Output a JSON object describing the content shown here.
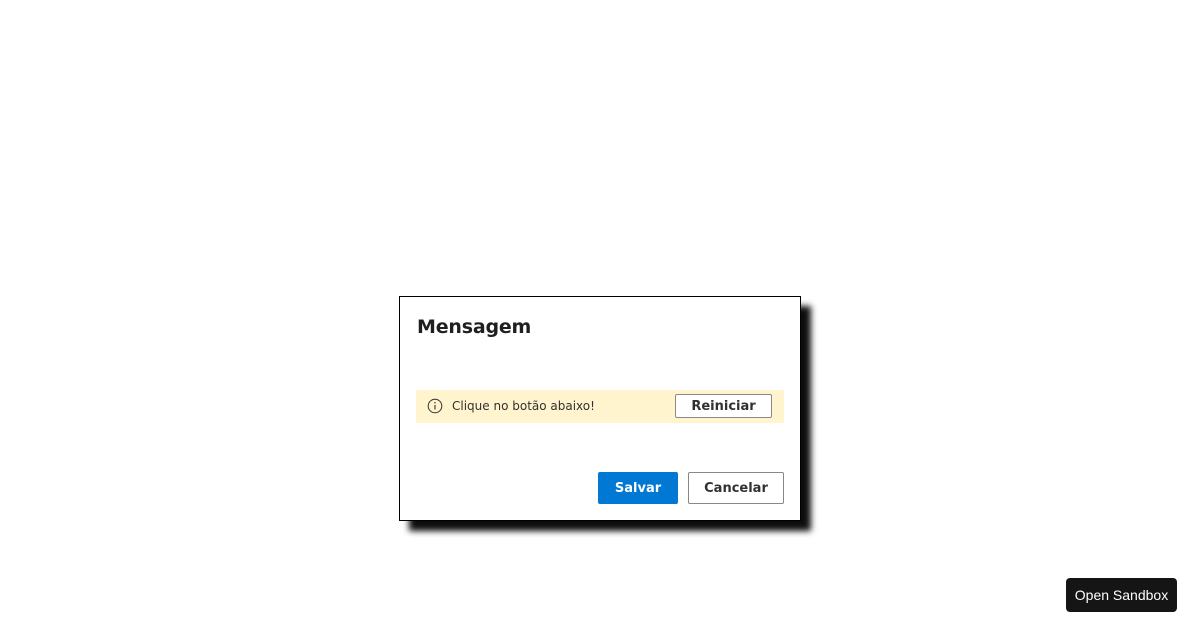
{
  "dialog": {
    "title": "Mensagem",
    "message_bar": {
      "icon": "info-icon",
      "text": "Clique no botão abaixo!",
      "action_label": "Reiniciar",
      "background": "#fff4ce"
    },
    "actions": {
      "save_label": "Salvar",
      "cancel_label": "Cancelar"
    }
  },
  "sandbox": {
    "label": "Open Sandbox"
  },
  "colors": {
    "primary": "#0078d4",
    "sandbox_bg": "#151515"
  }
}
